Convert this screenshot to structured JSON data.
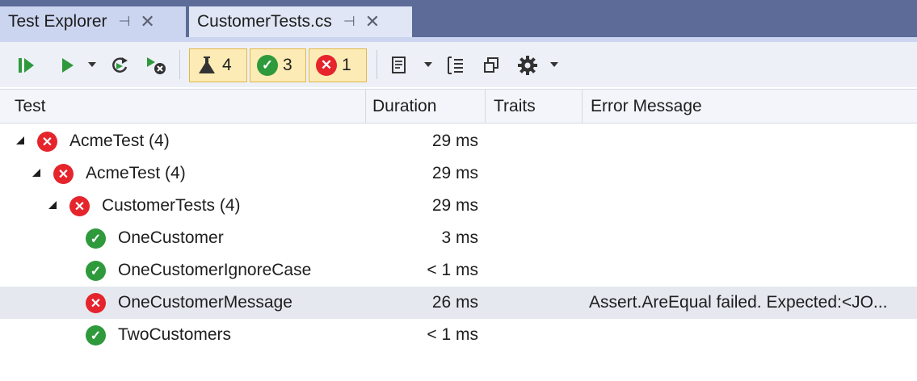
{
  "tabs": [
    {
      "label": "Test Explorer",
      "pin": "⊣",
      "close": "✕"
    },
    {
      "label": "CustomerTests.cs",
      "pin": "⊣",
      "close": "✕"
    }
  ],
  "toolbar": {
    "total_count": "4",
    "passed_count": "3",
    "failed_count": "1"
  },
  "columns": {
    "test": "Test",
    "duration": "Duration",
    "traits": "Traits",
    "error": "Error Message"
  },
  "rows": [
    {
      "name": "AcmeTest  (4)",
      "duration": "29 ms",
      "error": "",
      "status": "fail"
    },
    {
      "name": "AcmeTest  (4)",
      "duration": "29 ms",
      "error": "",
      "status": "fail"
    },
    {
      "name": "CustomerTests  (4)",
      "duration": "29 ms",
      "error": "",
      "status": "fail"
    },
    {
      "name": "OneCustomer",
      "duration": "3 ms",
      "error": "",
      "status": "pass"
    },
    {
      "name": "OneCustomerIgnoreCase",
      "duration": "< 1 ms",
      "error": "",
      "status": "pass"
    },
    {
      "name": "OneCustomerMessage",
      "duration": "26 ms",
      "error": "Assert.AreEqual failed. Expected:<JO...",
      "status": "fail"
    },
    {
      "name": "TwoCustomers",
      "duration": "< 1 ms",
      "error": "",
      "status": "pass"
    }
  ],
  "colors": {
    "tabstrip": "#5d6b99",
    "fail": "#e5242c",
    "pass": "#2e9a3c",
    "counter_bg": "#fcebb4"
  }
}
